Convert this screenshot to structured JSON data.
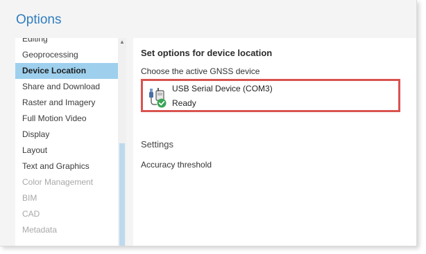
{
  "window": {
    "title": "Options"
  },
  "sidebar": {
    "items": [
      {
        "label": "Editing",
        "state": "normal"
      },
      {
        "label": "Geoprocessing",
        "state": "normal"
      },
      {
        "label": "Device Location",
        "state": "selected"
      },
      {
        "label": "Share and Download",
        "state": "normal"
      },
      {
        "label": "Raster and Imagery",
        "state": "normal"
      },
      {
        "label": "Full Motion Video",
        "state": "normal"
      },
      {
        "label": "Display",
        "state": "normal"
      },
      {
        "label": "Layout",
        "state": "normal"
      },
      {
        "label": "Text and Graphics",
        "state": "normal"
      },
      {
        "label": "Color Management",
        "state": "disabled"
      },
      {
        "label": "BIM",
        "state": "disabled"
      },
      {
        "label": "CAD",
        "state": "disabled"
      },
      {
        "label": "Metadata",
        "state": "disabled"
      }
    ],
    "scroll_up_icon": "triangle-up-icon"
  },
  "main": {
    "heading": "Set options for device location",
    "device_prompt": "Choose the active GNSS device",
    "device": {
      "name": "USB Serial Device (COM3)",
      "status": "Ready",
      "icon": "usb-device-icon",
      "status_icon": "check-circle-icon"
    },
    "settings_title": "Settings",
    "accuracy_label": "Accuracy threshold"
  },
  "colors": {
    "accent": "#2f7dbf",
    "selection": "#9ed0ee",
    "highlight_border": "#d9534f",
    "ready_green": "#3aa655"
  }
}
